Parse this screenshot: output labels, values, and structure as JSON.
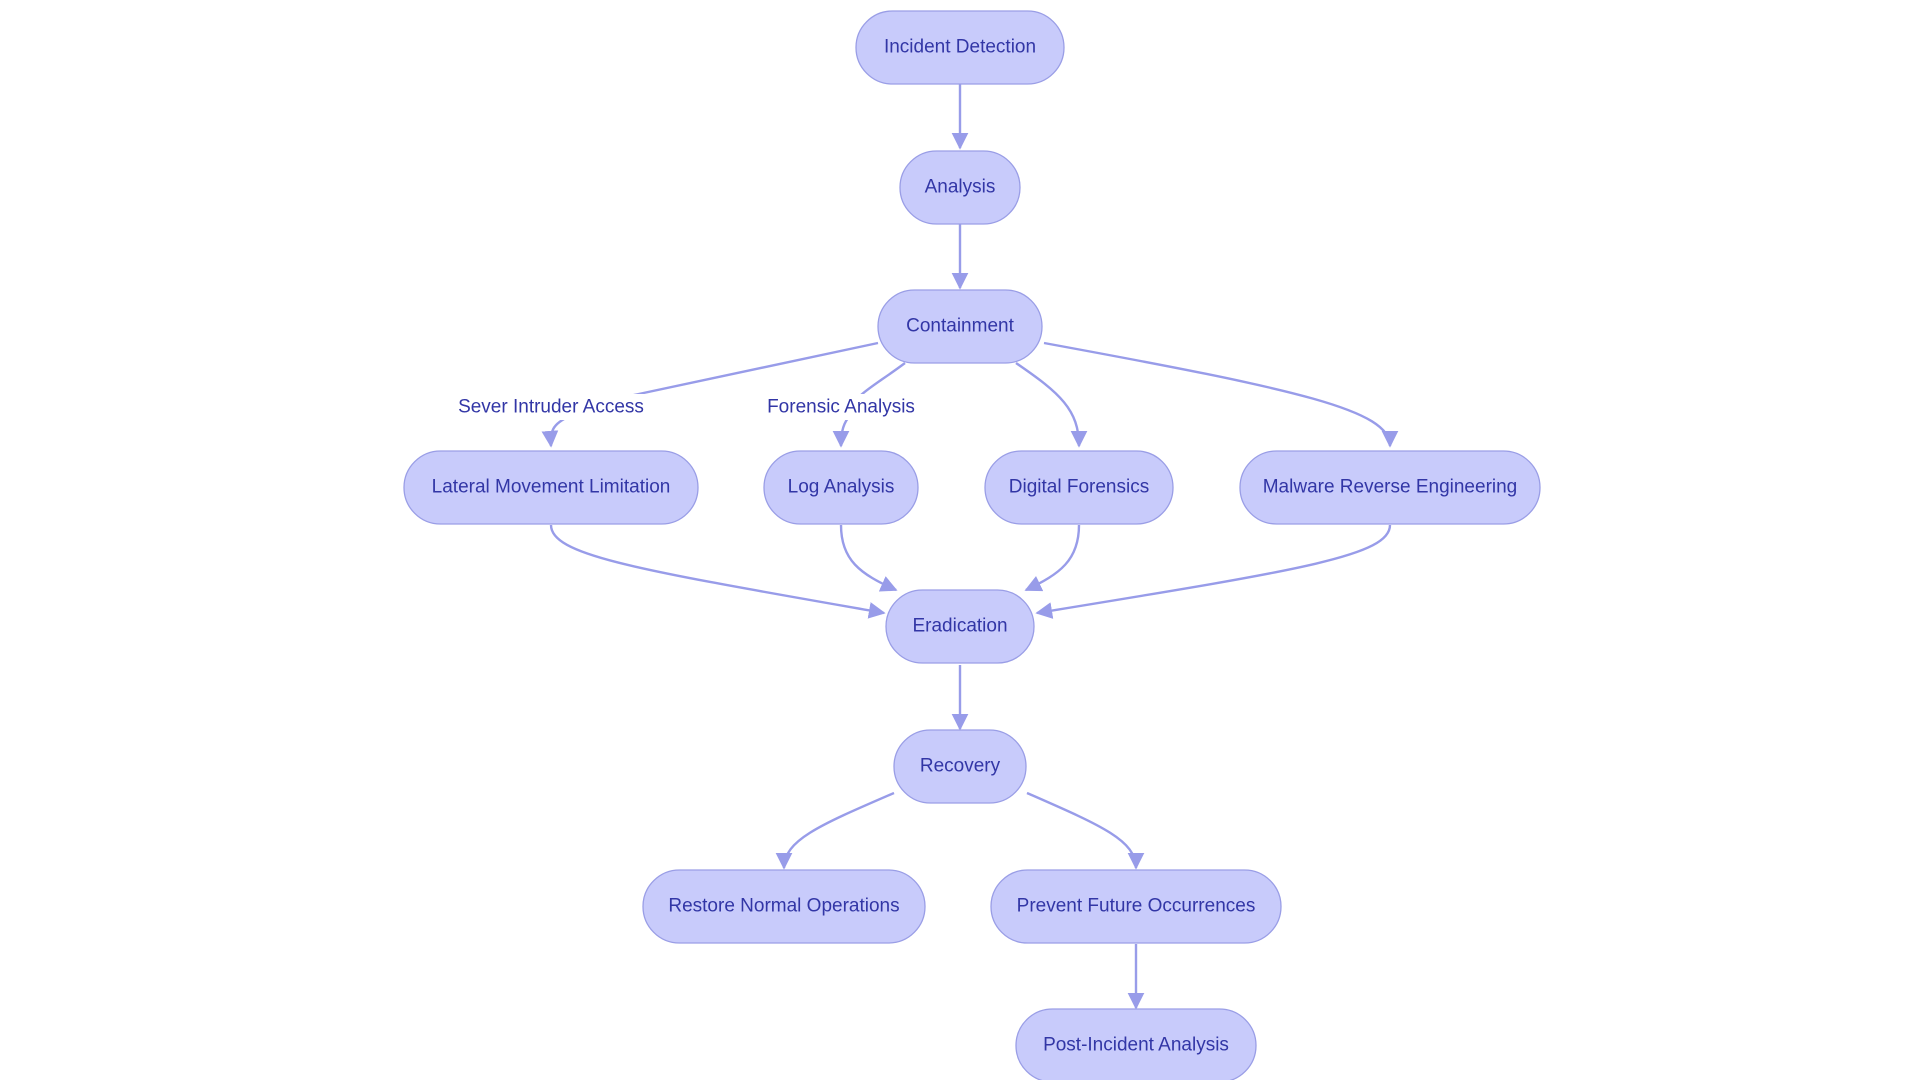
{
  "diagram": {
    "type": "flowchart",
    "direction": "top-down",
    "colors": {
      "node_fill": "#c8cbfb",
      "node_stroke": "#9a9ee6",
      "text": "#3236a6",
      "edge": "#989ce9"
    },
    "nodes": {
      "incident_detection": "Incident Detection",
      "analysis": "Analysis",
      "containment": "Containment",
      "lateral_movement_limitation": "Lateral Movement Limitation",
      "log_analysis": "Log Analysis",
      "digital_forensics": "Digital Forensics",
      "malware_reverse_engineering": "Malware Reverse Engineering",
      "eradication": "Eradication",
      "recovery": "Recovery",
      "restore_normal_operations": "Restore Normal Operations",
      "prevent_future_occurrences": "Prevent Future Occurrences",
      "post_incident_analysis": "Post-Incident Analysis"
    },
    "edges": [
      {
        "from": "incident_detection",
        "to": "analysis",
        "label": ""
      },
      {
        "from": "analysis",
        "to": "containment",
        "label": ""
      },
      {
        "from": "containment",
        "to": "lateral_movement_limitation",
        "label": "Sever Intruder Access"
      },
      {
        "from": "containment",
        "to": "log_analysis",
        "label": "Forensic Analysis"
      },
      {
        "from": "containment",
        "to": "digital_forensics",
        "label": ""
      },
      {
        "from": "containment",
        "to": "malware_reverse_engineering",
        "label": ""
      },
      {
        "from": "lateral_movement_limitation",
        "to": "eradication",
        "label": ""
      },
      {
        "from": "log_analysis",
        "to": "eradication",
        "label": ""
      },
      {
        "from": "digital_forensics",
        "to": "eradication",
        "label": ""
      },
      {
        "from": "malware_reverse_engineering",
        "to": "eradication",
        "label": ""
      },
      {
        "from": "eradication",
        "to": "recovery",
        "label": ""
      },
      {
        "from": "recovery",
        "to": "restore_normal_operations",
        "label": ""
      },
      {
        "from": "recovery",
        "to": "prevent_future_occurrences",
        "label": ""
      },
      {
        "from": "prevent_future_occurrences",
        "to": "post_incident_analysis",
        "label": ""
      }
    ],
    "edge_labels": {
      "sever_intruder_access": "Sever Intruder Access",
      "forensic_analysis": "Forensic Analysis"
    }
  }
}
